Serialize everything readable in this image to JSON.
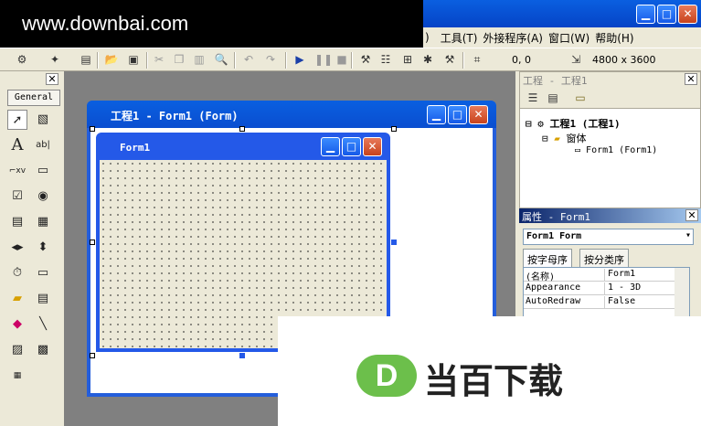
{
  "watermark": {
    "site": "www.downbai.com",
    "logo_letter": "D",
    "logo_text": "当百下载"
  },
  "menubar": {
    "items": [
      ")",
      "工具(T)",
      "外接程序(A)",
      "窗口(W)",
      "帮助(H)"
    ]
  },
  "toolbar": {
    "position": "0,  0",
    "size": "4800 x 3600"
  },
  "toolbox": {
    "tab_label": "General"
  },
  "form_designer": {
    "title": "工程1 - Form1 (Form)"
  },
  "form_window": {
    "title": "Form1"
  },
  "project_explorer": {
    "title": "工程 - 工程1",
    "tree": {
      "project": "工程1 (工程1)",
      "folder": "窗体",
      "form": "Form1 (Form1)"
    }
  },
  "properties": {
    "title": "属性 - Form1",
    "object_select": "Form1 Form",
    "tabs": [
      "按字母序",
      "按分类序"
    ],
    "rows": [
      {
        "name": "(名称)",
        "value": "Form1"
      },
      {
        "name": "Appearance",
        "value": "1 - 3D"
      },
      {
        "name": "AutoRedraw",
        "value": "False"
      }
    ]
  }
}
